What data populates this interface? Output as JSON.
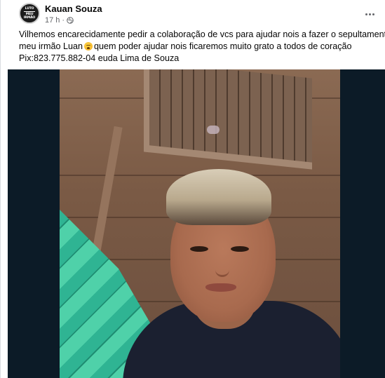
{
  "post": {
    "avatar": {
      "lines": [
        "LUTO",
        "MEU",
        "IRMÃO"
      ]
    },
    "author": "Kauan Souza",
    "time": "17 h",
    "separator": "·",
    "privacy_icon": "globe-icon",
    "more_icon": "more-options-icon",
    "caption": {
      "line1": "Vilhemos encarecidamente pedir a colaboração de vcs para ajudar nois a fazer o sepultamento do",
      "line2_before": "meu irmão Luan",
      "emoji": "crying-face-emoji",
      "line2_after": "quem poder ajudar nois ficaremos muito grato a todos de coração",
      "line3": "Pix:823.775.882-04 euda Lima de Souza"
    },
    "media": {
      "description_icon": "photo"
    }
  },
  "colors": {
    "text_primary": "#050505",
    "text_secondary": "#65676b",
    "media_background": "#0c1b27"
  }
}
